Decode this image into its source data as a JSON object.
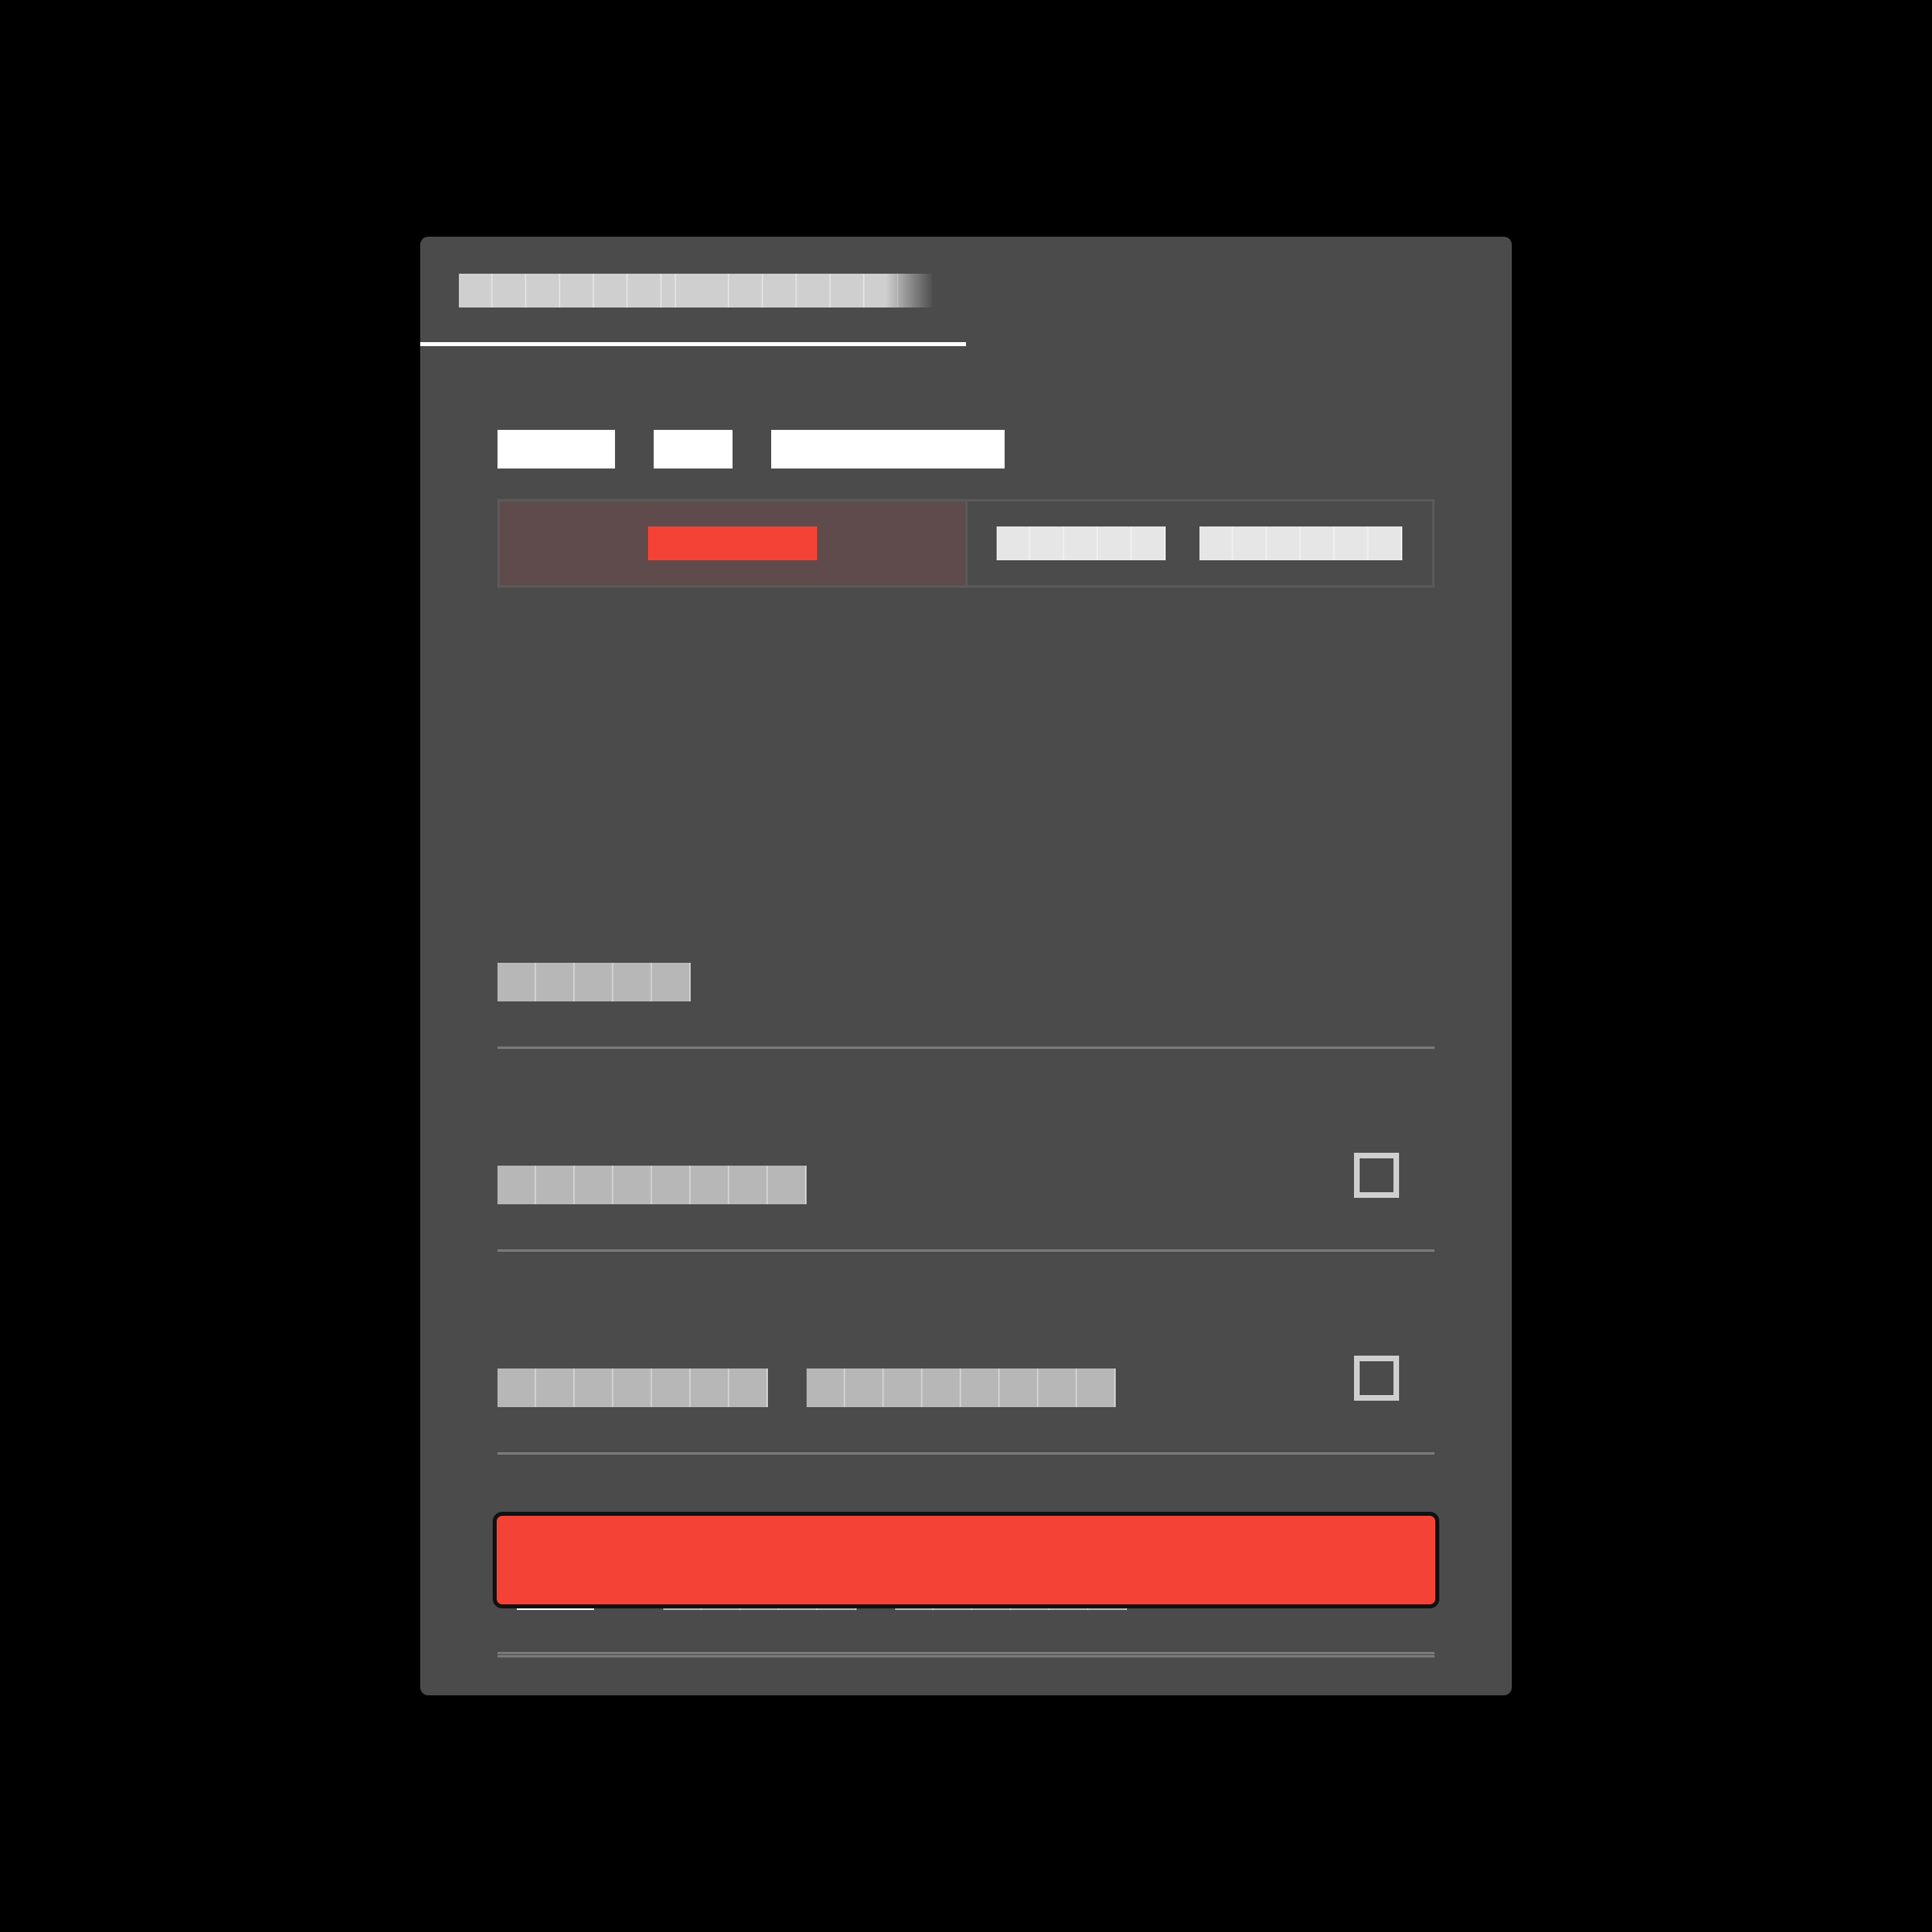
{
  "tabs": [
    {
      "label": "████ ██",
      "active": false
    },
    {
      "label": "██████ █████",
      "active": true
    }
  ],
  "title": [
    "███",
    "██",
    "██████"
  ],
  "segmented": {
    "options": [
      {
        "label": "█████",
        "selected": true
      },
      {
        "label": "█████ ██████",
        "selected": false
      }
    ]
  },
  "rows": [
    {
      "label": "█████",
      "has_checkbox": false
    },
    {
      "label": "████████",
      "has_checkbox": true,
      "checked": false
    },
    {
      "label": "███████ ████████",
      "has_checkbox": true,
      "checked": false
    },
    {
      "label": "█████ ██████",
      "has_value": true
    }
  ],
  "submit": {
    "label": "█████ ███████"
  },
  "colors": {
    "background": "#000000",
    "panel": "#4b4b4b",
    "accent": "#f44336",
    "selected_segment": "#5f4b4b",
    "tab_indicator": "#ffffff"
  }
}
